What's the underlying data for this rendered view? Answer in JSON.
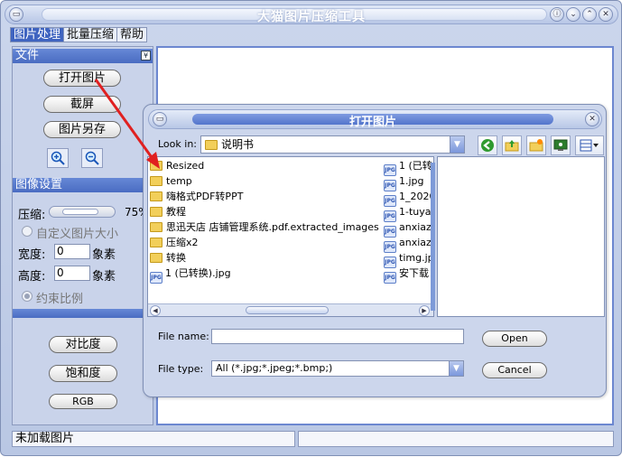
{
  "window": {
    "title": "大猫图片压缩工具",
    "controls": [
      "help-icon",
      "minimize-icon",
      "maximize-icon",
      "close-icon"
    ]
  },
  "menu": [
    {
      "label": "图片处理",
      "active": true
    },
    {
      "label": "批量压缩",
      "active": false
    },
    {
      "label": "帮助",
      "active": false
    }
  ],
  "left_panel": {
    "file_section": {
      "header": "文件",
      "open_label": "打开图片",
      "screenshot_label": "截屏",
      "save_as_label": "图片另存",
      "zoom_in_icon": "zoom-in-icon",
      "zoom_out_icon": "zoom-out-icon"
    },
    "image_settings": {
      "header": "图像设置",
      "compress_label": "压缩:",
      "compress_value": "75%",
      "compress_level": 0.75,
      "custom_size_label": "自定义图片大小",
      "width_label": "宽度:",
      "width_value": "0",
      "height_label": "高度:",
      "height_value": "0",
      "unit": "象素",
      "constrain_label": "约束比例"
    },
    "adjust": {
      "contrast_label": "对比度",
      "saturation_label": "饱和度",
      "rgb_label": "RGB"
    }
  },
  "status": {
    "left_text": "未加载图片",
    "right_text": ""
  },
  "dialog": {
    "title": "打开图片",
    "look_in_label": "Look in:",
    "look_in_value": "说明书",
    "toolbar_icons": [
      "back-icon",
      "up-folder-icon",
      "new-folder-icon",
      "desktop-icon",
      "view-menu-icon"
    ],
    "left_column": [
      {
        "type": "folder",
        "name": "Resized"
      },
      {
        "type": "folder",
        "name": "temp"
      },
      {
        "type": "folder",
        "name": "嗨格式PDF转PPT"
      },
      {
        "type": "folder",
        "name": "教程"
      },
      {
        "type": "folder",
        "name": "思迅天店 店铺管理系统.pdf.extracted_images"
      },
      {
        "type": "folder",
        "name": "压缩x2"
      },
      {
        "type": "folder",
        "name": "转换"
      },
      {
        "type": "jpg",
        "name": "1 (已转换).jpg"
      }
    ],
    "right_column": [
      {
        "type": "jpg",
        "name": "1 (已转"
      },
      {
        "type": "jpg",
        "name": "1.jpg"
      },
      {
        "type": "jpg",
        "name": "1_2020"
      },
      {
        "type": "jpg",
        "name": "1-tuya."
      },
      {
        "type": "jpg",
        "name": "anxiaz"
      },
      {
        "type": "jpg",
        "name": "anxiaz"
      },
      {
        "type": "jpg",
        "name": "timg.jp"
      },
      {
        "type": "jpg",
        "name": "安下载"
      }
    ],
    "file_name_label": "File name:",
    "file_name_value": "",
    "file_type_label": "File type:",
    "file_type_value": "All (*.jpg;*.jpeg;*.bmp;)",
    "open_button": "Open",
    "cancel_button": "Cancel"
  },
  "colors": {
    "accent": "#4a6cc2",
    "panel": "#c9d3ea",
    "annotation_arrow": "#e02020"
  }
}
